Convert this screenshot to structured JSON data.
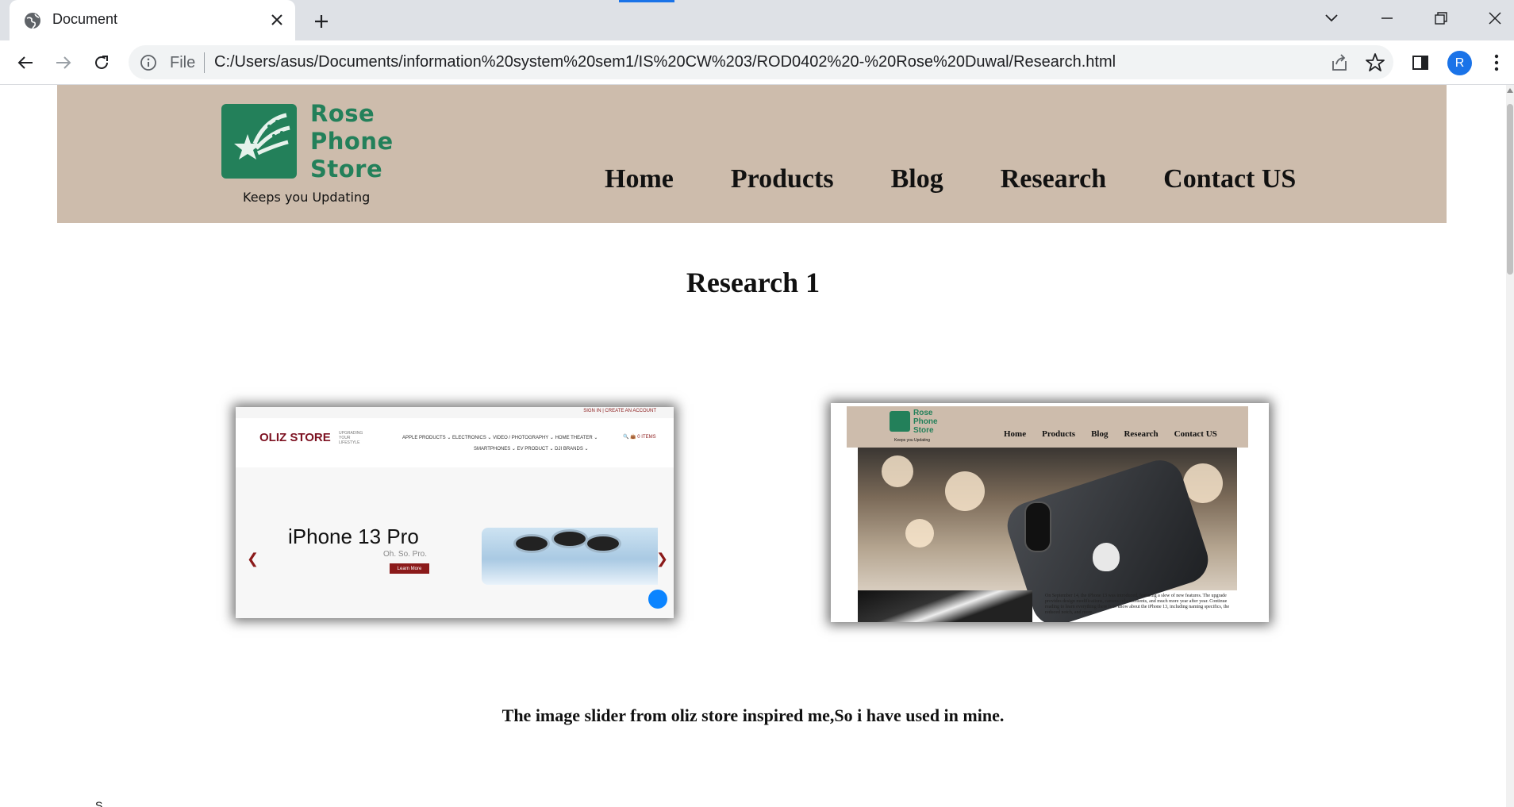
{
  "browser": {
    "tab_title": "Document",
    "address_scheme": "File",
    "address_url": "C:/Users/asus/Documents/information%20system%20sem1/IS%20CW%203/ROD0402%20-%20Rose%20Duwal/Research.html",
    "profile_initial": "R"
  },
  "site": {
    "logo_name": [
      "Rose",
      "Phone",
      "Store"
    ],
    "logo_tagline": "Keeps you Updating",
    "nav": [
      "Home",
      "Products",
      "Blog",
      "Research",
      "Contact US"
    ]
  },
  "content": {
    "heading": "Research 1",
    "caption": "The image slider from oliz store inspired me,So i have used in mine.",
    "cut_text": "S"
  },
  "oliz_screenshot": {
    "top_links": "SIGN IN  |  CREATE AN ACCOUNT",
    "logo": "OLIZ STORE",
    "logo_sub": "UPGRADING YOUR LIFESTYLE",
    "menu_row1": "APPLE PRODUCTS ⌄     ELECTRONICS ⌄     VIDEO / PHOTOGRAPHY ⌄     HOME THEATER ⌄",
    "menu_row2": "SMARTPHONES ⌄     EV PRODUCT ⌄     DJI     BRANDS ⌄",
    "cart": "0 ITEMS",
    "hero_title": "iPhone 13 Pro",
    "hero_subtitle": "Oh. So. Pro.",
    "hero_button": "Learn More"
  },
  "rose_screenshot": {
    "logo_name": [
      "Rose",
      "Phone",
      "Store"
    ],
    "logo_tagline": "Keeps you Updating",
    "nav": [
      "Home",
      "Products",
      "Blog",
      "Research",
      "Contact US"
    ],
    "body_text": "On September 14, the iPhone 13 was introduced, featuring a slew of new features. The upgrade provides design modifications, camera enhancements, and much more year after year. Continue reading to learn everything there is to know about the iPhone 13, including naming specifics, the reduced notch, and more."
  },
  "colors": {
    "header_bg": "#cdbcac",
    "brand_green": "#23805a",
    "oliz_red": "#8b1a1a"
  }
}
